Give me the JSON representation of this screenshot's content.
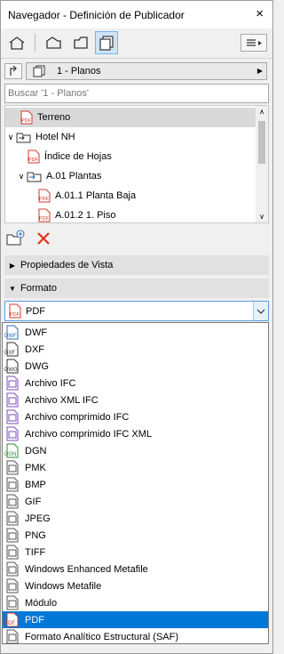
{
  "window": {
    "title": "Navegador - Definición de Publicador",
    "close_glyph": "×"
  },
  "modes": [
    {
      "icon": "project-map-icon",
      "active": false
    },
    {
      "icon": "view-map-icon",
      "active": false
    },
    {
      "icon": "layout-book-icon",
      "active": false
    },
    {
      "icon": "publisher-sets-icon",
      "active": true
    }
  ],
  "set": {
    "label": "1 - Planos"
  },
  "search": {
    "placeholder": "Buscar '1 - Planos'"
  },
  "tree": [
    {
      "label": "Terreno",
      "icon": "pdf-icon",
      "selected": true
    },
    {
      "label": "Hotel NH",
      "icon": "folder-link-icon",
      "twisty": "v"
    },
    {
      "label": "Índice de Hojas",
      "icon": "pdf-icon"
    },
    {
      "label": "A.01 Plantas",
      "icon": "folder-icon",
      "twisty": "v"
    },
    {
      "label": "A.01.1 Planta Baja",
      "icon": "pdf-icon"
    },
    {
      "label": "A.01.2 1. Piso",
      "icon": "pdf-icon"
    }
  ],
  "sections": {
    "view_props": "Propiedades de Vista",
    "format": "Formato"
  },
  "format": {
    "selected": "PDF",
    "options": [
      {
        "label": "DWF",
        "icon": "dwf-icon",
        "tag": "DWF",
        "color": "#2b6cb0"
      },
      {
        "label": "DXF",
        "icon": "dxf-icon",
        "tag": "DXF",
        "color": "#333333"
      },
      {
        "label": "DWG",
        "icon": "dwg-icon",
        "tag": "DWG",
        "color": "#333333"
      },
      {
        "label": "Archivo IFC",
        "icon": "ifc-icon",
        "tag": "",
        "color": "#7b4fb7"
      },
      {
        "label": "Archivo XML IFC",
        "icon": "ifc-xml-icon",
        "tag": "",
        "color": "#7b4fb7"
      },
      {
        "label": "Archivo comprimido IFC",
        "icon": "ifc-zip-icon",
        "tag": "",
        "color": "#7b4fb7"
      },
      {
        "label": "Archivo comprimido IFC XML",
        "icon": "ifc-zip-xml-icon",
        "tag": "",
        "color": "#7b4fb7"
      },
      {
        "label": "DGN",
        "icon": "dgn-icon",
        "tag": "DGN",
        "color": "#2e8b3e"
      },
      {
        "label": "PMK",
        "icon": "pmk-icon",
        "tag": "",
        "color": "#555555"
      },
      {
        "label": "BMP",
        "icon": "bmp-icon",
        "tag": "",
        "color": "#555555"
      },
      {
        "label": "GIF",
        "icon": "gif-icon",
        "tag": "",
        "color": "#555555"
      },
      {
        "label": "JPEG",
        "icon": "jpeg-icon",
        "tag": "",
        "color": "#555555"
      },
      {
        "label": "PNG",
        "icon": "png-icon",
        "tag": "",
        "color": "#555555"
      },
      {
        "label": "TIFF",
        "icon": "tiff-icon",
        "tag": "",
        "color": "#555555"
      },
      {
        "label": "Windows Enhanced Metafile",
        "icon": "emf-icon",
        "tag": "",
        "color": "#555555"
      },
      {
        "label": "Windows Metafile",
        "icon": "wmf-icon",
        "tag": "",
        "color": "#555555"
      },
      {
        "label": "Módulo",
        "icon": "module-icon",
        "tag": "",
        "color": "#555555"
      },
      {
        "label": "PDF",
        "icon": "pdf-icon",
        "tag": "PDF",
        "color": "#d33a2c"
      },
      {
        "label": "Formato Analítico Estructural (SAF)",
        "icon": "saf-icon",
        "tag": "",
        "color": "#555555"
      }
    ]
  },
  "colors": {
    "accent": "#0078d7",
    "pdf_red": "#d33a2c",
    "delete_red": "#e2311d"
  }
}
